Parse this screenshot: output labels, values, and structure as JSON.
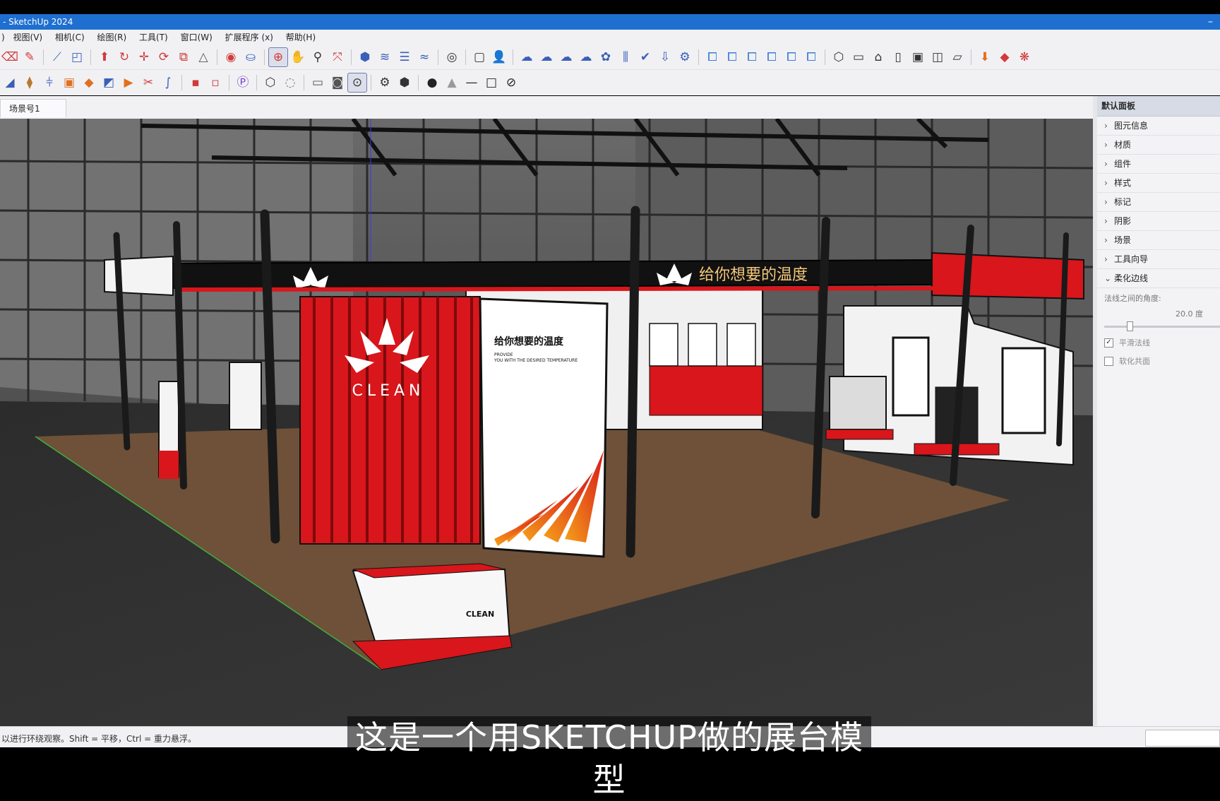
{
  "window": {
    "title": "- SketchUp 2024",
    "minimize_glyph": "–"
  },
  "menu": {
    "items": [
      ")",
      "视图(V)",
      "相机(C)",
      "绘图(R)",
      "工具(T)",
      "窗口(W)",
      "扩展程序 (x)",
      "帮助(H)"
    ]
  },
  "toolbar1": {
    "icons": [
      {
        "name": "eraser-icon",
        "glyph": "⌫",
        "color": "#d23a3a"
      },
      {
        "name": "pencil-icon",
        "glyph": "✎",
        "color": "#d23a3a"
      },
      {
        "sep": true
      },
      {
        "name": "line-tool-icon",
        "glyph": "⟋",
        "color": "#3a5fb8"
      },
      {
        "name": "rectangle-tool-icon",
        "glyph": "◰",
        "color": "#3a5fb8"
      },
      {
        "sep": true
      },
      {
        "name": "push-pull-icon",
        "glyph": "⬆",
        "color": "#d23a3a"
      },
      {
        "name": "follow-me-icon",
        "glyph": "↻",
        "color": "#d23a3a"
      },
      {
        "name": "move-icon",
        "glyph": "✛",
        "color": "#d23a3a"
      },
      {
        "name": "rotate-icon",
        "glyph": "⟳",
        "color": "#d23a3a"
      },
      {
        "name": "scale-icon",
        "glyph": "⧉",
        "color": "#d23a3a"
      },
      {
        "name": "offset-icon",
        "glyph": "△",
        "color": "#555555"
      },
      {
        "sep": true
      },
      {
        "name": "tape-measure-icon",
        "glyph": "◉",
        "color": "#d23a3a"
      },
      {
        "name": "paint-bucket-icon",
        "glyph": "⛀",
        "color": "#3a5fb8"
      },
      {
        "sep": true
      },
      {
        "name": "orbit-icon",
        "glyph": "⊕",
        "color": "#d23a3a",
        "selected": true
      },
      {
        "name": "pan-icon",
        "glyph": "✋",
        "color": "#d23a3a"
      },
      {
        "name": "zoom-icon",
        "glyph": "⚲",
        "color": "#333333"
      },
      {
        "name": "zoom-extents-icon",
        "glyph": "⤧",
        "color": "#d23a3a"
      },
      {
        "sep": true
      },
      {
        "name": "component-icon",
        "glyph": "⬢",
        "color": "#3a5fb8"
      },
      {
        "name": "section-plane-icon",
        "glyph": "≋",
        "color": "#3a5fb8"
      },
      {
        "name": "layers-icon",
        "glyph": "☰",
        "color": "#3a5fb8"
      },
      {
        "name": "sandbox-icon",
        "glyph": "≈",
        "color": "#3a5fb8"
      },
      {
        "sep": true
      },
      {
        "name": "account-icon",
        "glyph": "◎",
        "color": "#333333"
      },
      {
        "sep": true
      },
      {
        "name": "new-file-icon",
        "glyph": "▢",
        "color": "#333333"
      },
      {
        "name": "user-icon",
        "glyph": "👤",
        "color": "#3a5fb8"
      },
      {
        "sep": true
      },
      {
        "name": "cloud-icon",
        "glyph": "☁",
        "color": "#3a5fb8"
      },
      {
        "name": "cloud-search-icon",
        "glyph": "☁",
        "color": "#3a5fb8"
      },
      {
        "name": "cloud-upload-icon",
        "glyph": "☁",
        "color": "#3a5fb8"
      },
      {
        "name": "cloud-share-icon",
        "glyph": "☁",
        "color": "#3a5fb8"
      },
      {
        "name": "extension-warehouse-icon",
        "glyph": "✿",
        "color": "#3a5fb8"
      },
      {
        "name": "align-icon",
        "glyph": "⫼",
        "color": "#3a5fb8"
      },
      {
        "name": "check-icon",
        "glyph": "✔",
        "color": "#3a5fb8"
      },
      {
        "name": "download-icon",
        "glyph": "⇩",
        "color": "#3a5fb8"
      },
      {
        "name": "settings-gear-icon",
        "glyph": "⚙",
        "color": "#3a5fb8"
      },
      {
        "sep": true
      },
      {
        "name": "solid-union-icon",
        "glyph": "⧠",
        "color": "#3a7fd0"
      },
      {
        "name": "solid-subtract-icon",
        "glyph": "⧠",
        "color": "#3a7fd0"
      },
      {
        "name": "solid-trim-icon",
        "glyph": "⧠",
        "color": "#3a7fd0"
      },
      {
        "name": "solid-intersect-icon",
        "glyph": "⧠",
        "color": "#3a7fd0"
      },
      {
        "name": "solid-split-icon",
        "glyph": "⧠",
        "color": "#3a7fd0"
      },
      {
        "name": "solid-outer-shell-icon",
        "glyph": "⧠",
        "color": "#3a7fd0"
      },
      {
        "sep": true
      },
      {
        "name": "iso-view-icon",
        "glyph": "⬡",
        "color": "#333333"
      },
      {
        "name": "top-view-icon",
        "glyph": "▭",
        "color": "#333333"
      },
      {
        "name": "front-view-icon",
        "glyph": "⌂",
        "color": "#333333"
      },
      {
        "name": "right-view-icon",
        "glyph": "▯",
        "color": "#333333"
      },
      {
        "name": "back-view-icon",
        "glyph": "▣",
        "color": "#333333"
      },
      {
        "name": "left-view-icon",
        "glyph": "◫",
        "color": "#333333"
      },
      {
        "name": "bottom-view-icon",
        "glyph": "▱",
        "color": "#333333"
      },
      {
        "sep": true
      },
      {
        "name": "plugin-import-icon",
        "glyph": "⬇",
        "color": "#e07020"
      },
      {
        "name": "plugin-ruby-icon",
        "glyph": "◆",
        "color": "#d23a3a"
      },
      {
        "name": "plugin-render-icon",
        "glyph": "❋",
        "color": "#d23a3a"
      }
    ]
  },
  "toolbar2": {
    "icons": [
      {
        "name": "sandbox-from-scratch-icon",
        "glyph": "◢",
        "color": "#3a5fb8"
      },
      {
        "name": "materials-tool-icon",
        "glyph": "⧫",
        "color": "#b87a30"
      },
      {
        "name": "hierarchy-icon",
        "glyph": "⫩",
        "color": "#3a5fb8"
      },
      {
        "name": "box-tool-icon",
        "glyph": "▣",
        "color": "#e07020"
      },
      {
        "name": "shapes-icon",
        "glyph": "◆",
        "color": "#e07020"
      },
      {
        "name": "drape-icon",
        "glyph": "◩",
        "color": "#3a5fb8"
      },
      {
        "name": "stamp-icon",
        "glyph": "▶",
        "color": "#e07020"
      },
      {
        "name": "cut-icon",
        "glyph": "✂",
        "color": "#d23a3a"
      },
      {
        "name": "curve-icon",
        "glyph": "∫",
        "color": "#3a5fb8"
      },
      {
        "sep": true
      },
      {
        "name": "group-icon",
        "glyph": "▪",
        "color": "#d23a3a"
      },
      {
        "name": "component-edit-icon",
        "glyph": "▫",
        "color": "#d23a3a"
      },
      {
        "sep": true
      },
      {
        "name": "profile-plugin-icon",
        "glyph": "Ⓟ",
        "color": "#7a3ad0"
      },
      {
        "sep": true
      },
      {
        "name": "wireframe-cube-icon",
        "glyph": "⬡",
        "color": "#333333"
      },
      {
        "name": "xray-icon",
        "glyph": "◌",
        "color": "#777777"
      },
      {
        "sep": true
      },
      {
        "name": "video-camera-icon",
        "glyph": "▭",
        "color": "#555555"
      },
      {
        "name": "camera-icon",
        "glyph": "◙",
        "color": "#555555"
      },
      {
        "name": "walk-icon",
        "glyph": "⊙",
        "color": "#333333",
        "selected": true
      },
      {
        "sep": true
      },
      {
        "name": "style-gear-icon",
        "glyph": "⚙",
        "color": "#333333"
      },
      {
        "name": "export-cube-icon",
        "glyph": "⬢",
        "color": "#333333"
      },
      {
        "sep": true
      },
      {
        "name": "shadow-sun-icon",
        "glyph": "●",
        "color": "#222222"
      },
      {
        "name": "fog-icon",
        "glyph": "▲",
        "color": "#999999"
      },
      {
        "name": "edge-line-icon",
        "glyph": "—",
        "color": "#222222"
      },
      {
        "name": "face-rect-icon",
        "glyph": "□",
        "color": "#222222"
      },
      {
        "name": "hidden-geometry-icon",
        "glyph": "⊘",
        "color": "#222222"
      }
    ]
  },
  "scene_tab": {
    "label": "场景号1"
  },
  "booth": {
    "slogan": "给你想要的温度",
    "logo_text": "CLEAN",
    "panel_headline": "给你想要的温度",
    "panel_sub1": "PROVIDE",
    "panel_sub2": "YOU WITH THE DESIRED TEMPERATURE",
    "accent_color": "#d8161b",
    "floor_color": "#6e5138"
  },
  "tray": {
    "title": "默认面板",
    "items": [
      {
        "label": "图元信息",
        "expanded": false
      },
      {
        "label": "材质",
        "expanded": false
      },
      {
        "label": "组件",
        "expanded": false
      },
      {
        "label": "样式",
        "expanded": false
      },
      {
        "label": "标记",
        "expanded": false
      },
      {
        "label": "阴影",
        "expanded": false
      },
      {
        "label": "场景",
        "expanded": false
      },
      {
        "label": "工具向导",
        "expanded": false
      },
      {
        "label": "柔化边线",
        "expanded": true
      }
    ],
    "soften": {
      "angle_label": "法线之间的角度:",
      "angle_value": "20.0",
      "angle_unit": "度",
      "normals_label": "平滑法线",
      "normals_checked": true,
      "coplanar_label": "软化共面",
      "coplanar_checked": false
    }
  },
  "status": {
    "text": "以进行环绕观察。Shift = 平移，Ctrl = 重力悬浮。"
  },
  "subtitle": {
    "text": "这是一个用SKETCHUP做的展台模型"
  }
}
